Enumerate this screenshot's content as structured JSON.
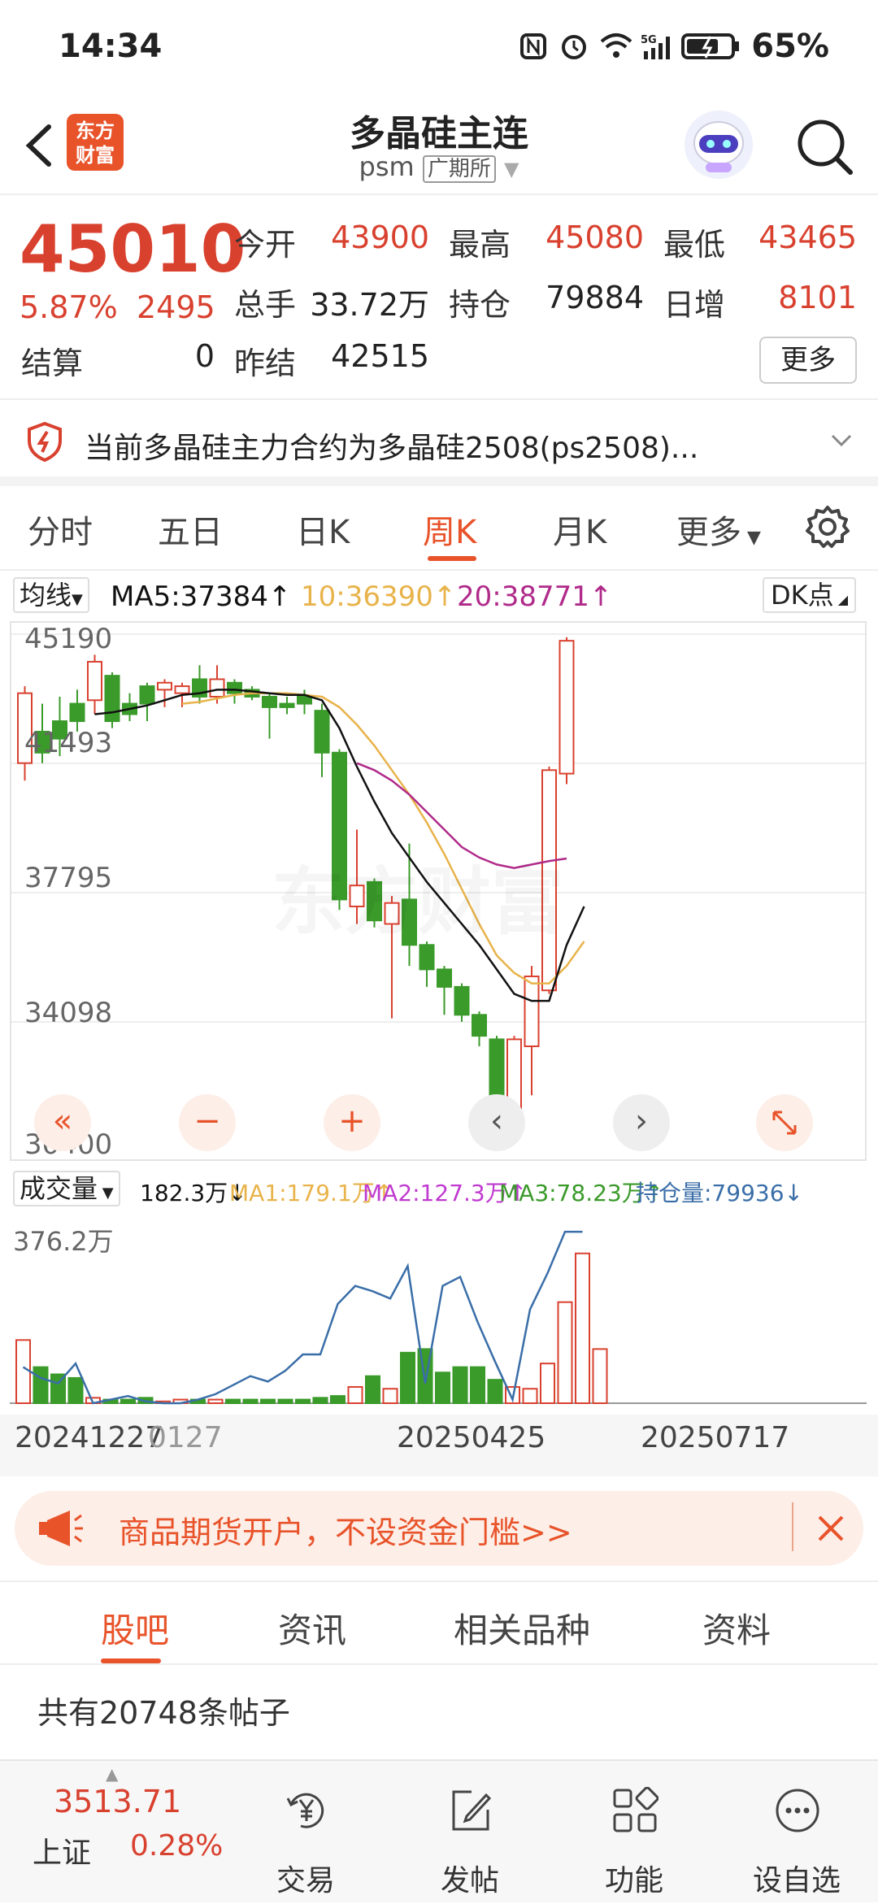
{
  "status": {
    "time": "14:34",
    "battery": "65%"
  },
  "header": {
    "logo_text": "东方财富",
    "title": "多晶硅主连",
    "code": "psm",
    "exchange": "广期所"
  },
  "quote": {
    "price": "45010",
    "change_pct": "5.87%",
    "change": "2495",
    "open_label": "今开",
    "open": "43900",
    "high_label": "最高",
    "high": "45080",
    "low_label": "最低",
    "low": "43465",
    "volume_label": "总手",
    "volume": "33.72万",
    "oi_label": "持仓",
    "oi": "79884",
    "daily_inc_label": "日增",
    "daily_inc": "8101",
    "settle_label": "结算",
    "settle": "0",
    "prev_settle_label": "昨结",
    "prev_settle": "42515",
    "more_label": "更多"
  },
  "notice": {
    "text": "当前多晶硅主力合约为多晶硅2508(ps2508)..."
  },
  "tabs": [
    {
      "label": "分时"
    },
    {
      "label": "五日"
    },
    {
      "label": "日K"
    },
    {
      "label": "周K"
    },
    {
      "label": "月K"
    },
    {
      "label": "更多"
    }
  ],
  "ma_legend": {
    "selector": "均线",
    "ma5": "MA5:37384↑",
    "ma10": "10:36390↑",
    "ma20": "20:38771↑",
    "dk": "DK点"
  },
  "vol_legend": {
    "selector": "成交量",
    "vol": "182.3万↓",
    "ma1": "MA1:179.1万↑",
    "ma2": "MA2:127.3万↑",
    "ma3": "MA3:78.23万↑",
    "oi": "持仓量:79936↓"
  },
  "colors": {
    "up": "#d9412f",
    "down": "#3a9a2a",
    "accent": "#e8532a",
    "ma5": "#111111",
    "ma10": "#e8b34a",
    "ma20": "#b02a8a"
  },
  "chart_data": {
    "type": "candlestick",
    "ylim": [
      30400,
      45190
    ],
    "y_ticks": [
      "45190",
      "41493",
      "37795",
      "34098",
      "30400"
    ],
    "vol_max_label": "376.2万",
    "x_tick_labels": [
      "20241227",
      "0127",
      "20250425",
      "20250717"
    ],
    "candles": [
      [
        41500,
        43500,
        41000,
        43700
      ],
      [
        42400,
        41800,
        41500,
        43200
      ],
      [
        42700,
        42200,
        41700,
        43400
      ],
      [
        43200,
        42700,
        42400,
        43600
      ],
      [
        43300,
        44400,
        42900,
        44600
      ],
      [
        44000,
        42700,
        42500,
        44100
      ],
      [
        43200,
        42900,
        42700,
        43500
      ],
      [
        43700,
        43200,
        42700,
        43800
      ],
      [
        43600,
        43800,
        43100,
        43900
      ],
      [
        43500,
        43700,
        43100,
        43800
      ],
      [
        43900,
        43400,
        43200,
        44300
      ],
      [
        43400,
        43900,
        43200,
        44300
      ],
      [
        43800,
        43500,
        43200,
        43900
      ],
      [
        43600,
        43400,
        43300,
        43700
      ],
      [
        43400,
        43100,
        42200,
        43500
      ],
      [
        43200,
        43100,
        42900,
        43400
      ],
      [
        43400,
        43200,
        42900,
        43600
      ],
      [
        43000,
        41800,
        41100,
        43200
      ],
      [
        41800,
        37600,
        37300,
        41900
      ],
      [
        37400,
        38000,
        36900,
        39600
      ],
      [
        38100,
        37000,
        36800,
        38200
      ],
      [
        36900,
        37500,
        34200,
        37700
      ],
      [
        37600,
        36300,
        35700,
        39200
      ],
      [
        36300,
        35600,
        35100,
        36400
      ],
      [
        35600,
        35100,
        34300,
        35700
      ],
      [
        35100,
        34300,
        34100,
        35200
      ],
      [
        34300,
        33700,
        33400,
        34400
      ],
      [
        33600,
        31600,
        31300,
        33700
      ],
      [
        31600,
        33600,
        30700,
        33700
      ],
      [
        33400,
        35400,
        32000,
        35700
      ],
      [
        35000,
        41300,
        34900,
        41400
      ],
      [
        41200,
        45000,
        40900,
        45100
      ]
    ],
    "ma5": [
      null,
      null,
      null,
      null,
      42900,
      42950,
      43050,
      43150,
      43300,
      43450,
      43500,
      43600,
      43600,
      43550,
      43500,
      43450,
      43450,
      43300,
      42500,
      41400,
      40400,
      39500,
      38800,
      38100,
      37500,
      36900,
      36300,
      35600,
      34900,
      34700,
      34700,
      36300,
      37400
    ],
    "ma10": [
      null,
      null,
      null,
      null,
      null,
      null,
      null,
      null,
      null,
      43200,
      43250,
      43350,
      43450,
      43500,
      43500,
      43500,
      43450,
      43400,
      43100,
      42600,
      42000,
      41300,
      40600,
      39800,
      38900,
      37900,
      36900,
      36000,
      35500,
      35200,
      35200,
      35700,
      36400
    ],
    "ma20": [
      null,
      null,
      null,
      null,
      null,
      null,
      null,
      null,
      null,
      null,
      null,
      null,
      null,
      null,
      null,
      null,
      null,
      null,
      null,
      41500,
      41300,
      41000,
      40600,
      40100,
      39600,
      39100,
      38800,
      38600,
      38500,
      38600,
      38700,
      38771
    ],
    "volume": [
      0.35,
      0.2,
      0.16,
      0.14,
      0.03,
      0.02,
      0.02,
      0.03,
      0.01,
      0.02,
      0.02,
      0.02,
      0.02,
      0.02,
      0.02,
      0.02,
      0.02,
      0.03,
      0.04,
      0.09,
      0.15,
      0.08,
      0.28,
      0.3,
      0.17,
      0.2,
      0.2,
      0.13,
      0.09,
      0.08,
      0.22,
      0.56,
      0.83,
      0.3
    ],
    "oi_line": [
      0.2,
      0.14,
      0.11,
      0.22,
      0.0,
      0.02,
      0.04,
      0.01,
      0.0,
      0.0,
      0.02,
      0.05,
      0.1,
      0.15,
      0.12,
      0.18,
      0.27,
      0.27,
      0.55,
      0.65,
      0.62,
      0.58,
      0.76,
      0.11,
      0.65,
      0.7,
      0.45,
      0.23,
      0.02,
      0.52,
      0.72,
      0.95,
      0.95
    ]
  },
  "banner": {
    "text": "商品期货开户，不设资金门槛>>"
  },
  "section_tabs": [
    {
      "label": "股吧"
    },
    {
      "label": "资讯"
    },
    {
      "label": "相关品种"
    },
    {
      "label": "资料"
    }
  ],
  "post_count": "共有20748条帖子",
  "bottom_nav": {
    "index_value": "3513.71",
    "index_name": "上证",
    "index_change": "0.28%",
    "items": [
      {
        "label": "交易"
      },
      {
        "label": "发帖"
      },
      {
        "label": "功能"
      },
      {
        "label": "设自选"
      }
    ]
  }
}
